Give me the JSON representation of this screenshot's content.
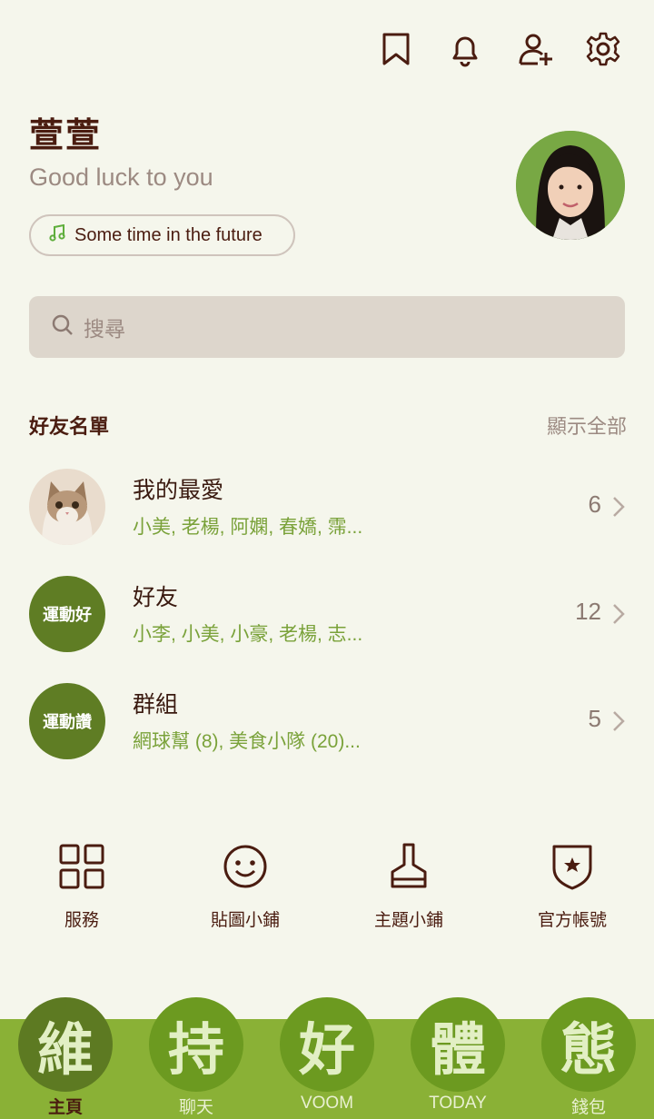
{
  "profile": {
    "name": "萱萱",
    "status": "Good luck to you",
    "music": "Some time in the future"
  },
  "search": {
    "placeholder": "搜尋"
  },
  "friends_section": {
    "title": "好友名單",
    "show_all": "顯示全部",
    "rows": [
      {
        "title": "我的最愛",
        "members": "小美, 老楊, 阿嫻, 春嬌, 霈...",
        "count": "6"
      },
      {
        "title": "好友",
        "badge": "運動好",
        "members": "小李, 小美, 小豪, 老楊, 志...",
        "count": "12"
      },
      {
        "title": "群組",
        "badge": "運動讚",
        "members": "網球幫 (8), 美食小隊 (20)...",
        "count": "5"
      }
    ]
  },
  "services": [
    {
      "label": "服務",
      "icon": "grid-icon"
    },
    {
      "label": "貼圖小鋪",
      "icon": "smiley-icon"
    },
    {
      "label": "主題小鋪",
      "icon": "brush-icon"
    },
    {
      "label": "官方帳號",
      "icon": "shield-star-icon"
    }
  ],
  "tabs": [
    {
      "glyph": "維",
      "label": "主頁",
      "active": true
    },
    {
      "glyph": "持",
      "label": "聊天"
    },
    {
      "glyph": "好",
      "label": "VOOM"
    },
    {
      "glyph": "體",
      "label": "TODAY"
    },
    {
      "glyph": "態",
      "label": "錢包"
    }
  ],
  "colors": {
    "background": "#f5f6ec",
    "text_dark": "#4a1c10",
    "accent_green": "#7aa23a",
    "tabbar_green": "#8ab136",
    "badge_green": "#5f7d24"
  }
}
